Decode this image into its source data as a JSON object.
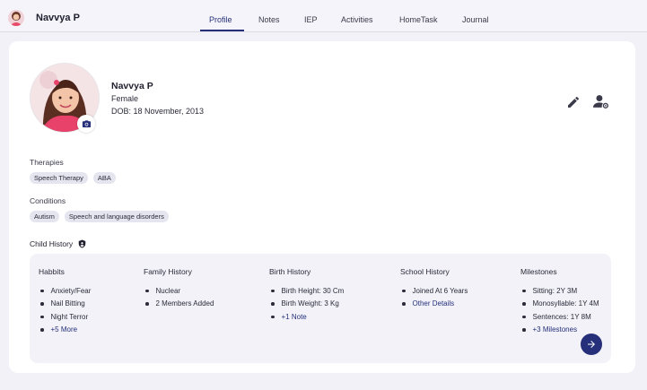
{
  "header": {
    "name": "Navvya P",
    "tabs": [
      {
        "label": "Profile",
        "active": true
      },
      {
        "label": "Notes"
      },
      {
        "label": "IEP"
      },
      {
        "label": "Activities"
      },
      {
        "label": "HomeTask"
      },
      {
        "label": "Journal"
      }
    ]
  },
  "profile": {
    "name": "Navvya P",
    "gender": "Female",
    "dob": "DOB: 18 November, 2013"
  },
  "therapies": {
    "label": "Therapies",
    "items": [
      "Speech Therapy",
      "ABA"
    ]
  },
  "conditions": {
    "label": "Conditions",
    "items": [
      "Autism",
      "Speech and language disorders"
    ]
  },
  "child_history": {
    "title": "Child History",
    "columns": [
      {
        "title": "Habbits",
        "items": [
          "Anxiety/Fear",
          "Nail Bitting",
          "Night Terror"
        ],
        "more": "+5 More"
      },
      {
        "title": "Family History",
        "items": [
          "Nuclear",
          "2 Members Added"
        ],
        "more": ""
      },
      {
        "title": "Birth History",
        "items": [
          "Birth Height: 30 Cm",
          "Birth Weight: 3 Kg"
        ],
        "more": "+1 Note"
      },
      {
        "title": "School History",
        "items": [
          "Joined At 6 Years"
        ],
        "more": "Other Details"
      },
      {
        "title": "Milestones",
        "items": [
          "Sitting: 2Y 3M",
          "Monosyllable: 1Y 4M",
          "Sentences: 1Y 8M"
        ],
        "more": "+3 Milestones"
      }
    ]
  },
  "colors": {
    "accent": "#26307a",
    "background": "#f2f1f8",
    "chip": "#e4e5ee"
  },
  "icons": [
    "camera-icon",
    "edit-pencil-icon",
    "user-settings-icon",
    "shield-icon",
    "arrow-right-icon"
  ]
}
